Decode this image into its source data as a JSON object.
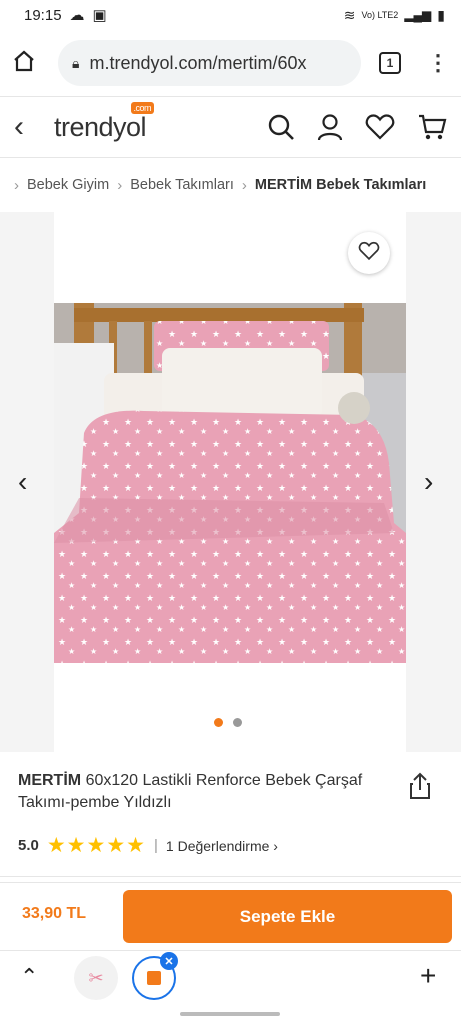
{
  "status_bar": {
    "time": "19:15",
    "network": "Vo) LTE2"
  },
  "browser": {
    "url": "m.trendyol.com/mertim/60x",
    "tab_count": "1"
  },
  "header": {
    "logo": "trendyol",
    "logo_badge": ".com"
  },
  "breadcrumb": {
    "items": [
      "Bebek Giyim",
      "Bebek Takımları",
      "MERTİM Bebek Takımları"
    ]
  },
  "product": {
    "brand": "MERTİM",
    "name": "60x120 Lastikli Renforce Bebek Çarşaf Takımı-pembe Yıldızlı",
    "rating": "5.0",
    "stars": "★★★★★",
    "review_count": "1 Değerlendirme",
    "price": "33,90 TL",
    "add_to_cart": "Sepete Ekle",
    "image_count": 2,
    "active_image": 1
  },
  "colors": {
    "accent": "#f27a1a",
    "star": "#ffc000",
    "tab_blue": "#1a73e8"
  },
  "icons": [
    "home-icon",
    "lock-icon",
    "kebab-menu-icon",
    "back-icon",
    "search-icon",
    "user-icon",
    "heart-icon",
    "cart-icon",
    "share-icon",
    "chevron-left-icon",
    "chevron-right-icon",
    "chevron-up-icon",
    "plus-icon"
  ]
}
